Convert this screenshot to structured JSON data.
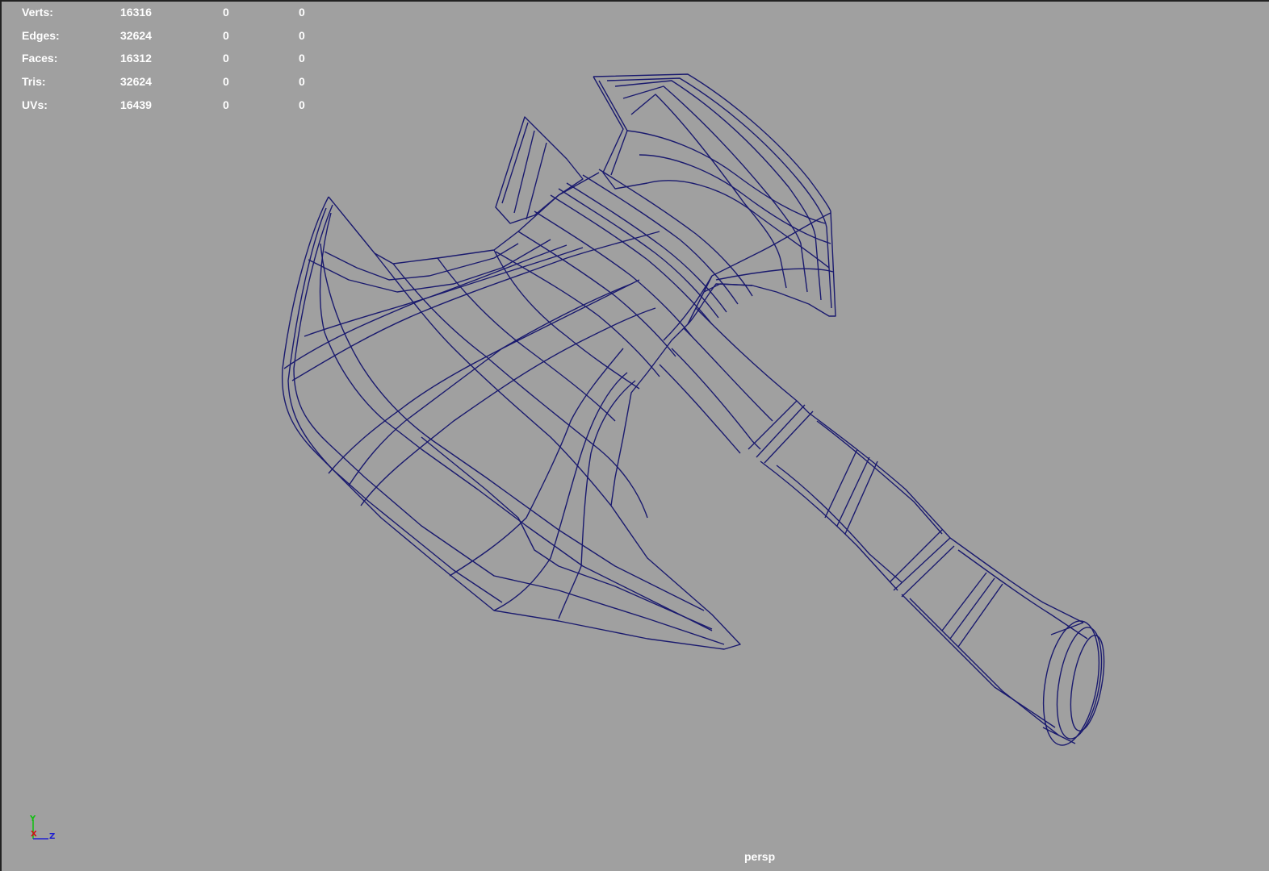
{
  "hud": {
    "rows": [
      {
        "label": "Verts:",
        "v1": "16316",
        "v2": "0",
        "v3": "0"
      },
      {
        "label": "Edges:",
        "v1": "32624",
        "v2": "0",
        "v3": "0"
      },
      {
        "label": "Faces:",
        "v1": "16312",
        "v2": "0",
        "v3": "0"
      },
      {
        "label": "Tris:",
        "v1": "32624",
        "v2": "0",
        "v3": "0"
      },
      {
        "label": "UVs:",
        "v1": "16439",
        "v2": "0",
        "v3": "0"
      }
    ]
  },
  "axis": {
    "y": "Y",
    "x": "X",
    "z": "Z"
  },
  "camera": {
    "label": "persp"
  },
  "colors": {
    "background": "#a0a0a0",
    "wireframe": "#1a1a6e",
    "hud_text": "#ffffff",
    "axis_x": "#d01010",
    "axis_y": "#10c010",
    "axis_z": "#2020d0"
  },
  "mesh": {
    "object": "axe",
    "display_mode": "wireframe"
  }
}
